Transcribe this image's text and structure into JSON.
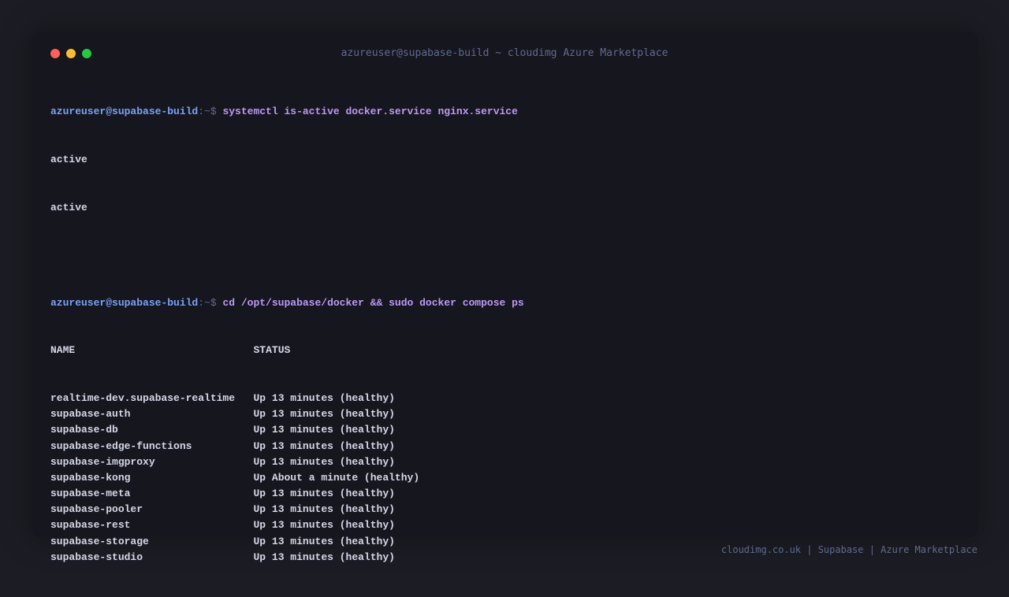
{
  "window": {
    "title": "azureuser@supabase-build ~ cloudimg Azure Marketplace"
  },
  "colors": {
    "prompt_user": "#7aa2f7",
    "command": "#bb9af7",
    "output": "#d4d8e8",
    "muted": "#5f6b8f",
    "close": "#ff5f57",
    "minimize": "#febc2e",
    "maximize": "#28c840"
  },
  "terminal": {
    "prompt_user": "azureuser@supabase-build",
    "prompt_sep": ":~$ ",
    "cmd1": "systemctl is-active docker.service nginx.service",
    "cmd1_output": [
      "active",
      "active"
    ],
    "cmd2": "cd /opt/supabase/docker && sudo docker compose ps",
    "table": {
      "headers": [
        "NAME",
        "STATUS"
      ],
      "rows": [
        [
          "realtime-dev.supabase-realtime",
          "Up 13 minutes (healthy)"
        ],
        [
          "supabase-auth",
          "Up 13 minutes (healthy)"
        ],
        [
          "supabase-db",
          "Up 13 minutes (healthy)"
        ],
        [
          "supabase-edge-functions",
          "Up 13 minutes (healthy)"
        ],
        [
          "supabase-imgproxy",
          "Up 13 minutes (healthy)"
        ],
        [
          "supabase-kong",
          "Up About a minute (healthy)"
        ],
        [
          "supabase-meta",
          "Up 13 minutes (healthy)"
        ],
        [
          "supabase-pooler",
          "Up 13 minutes (healthy)"
        ],
        [
          "supabase-rest",
          "Up 13 minutes (healthy)"
        ],
        [
          "supabase-storage",
          "Up 13 minutes (healthy)"
        ],
        [
          "supabase-studio",
          "Up 13 minutes (healthy)"
        ]
      ]
    }
  },
  "footer": {
    "text": "cloudimg.co.uk | Supabase | Azure Marketplace"
  }
}
